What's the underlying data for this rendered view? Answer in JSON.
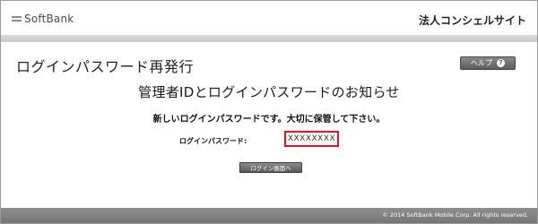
{
  "header": {
    "logo_text": "SoftBank",
    "service_name": "法人コンシェルサイト"
  },
  "page": {
    "title": "ログインパスワード再発行",
    "help_button_label": "ヘルプ",
    "help_icon": "question-circle-icon",
    "heading": "管理者IDとログインパスワードのお知らせ",
    "notice": "新しいログインパスワードです。大切に保管して下さい。",
    "password_label": "ログインパスワード:",
    "password_value": "XXXXXXXX",
    "login_button_label": "ログイン画面へ"
  },
  "footer": {
    "copyright": "© 2014 SoftBank Mobile Corp. All rights reserved."
  },
  "colors": {
    "highlight_border": "#e8112d",
    "band": "#d0d0d0",
    "footer": "#808080"
  }
}
